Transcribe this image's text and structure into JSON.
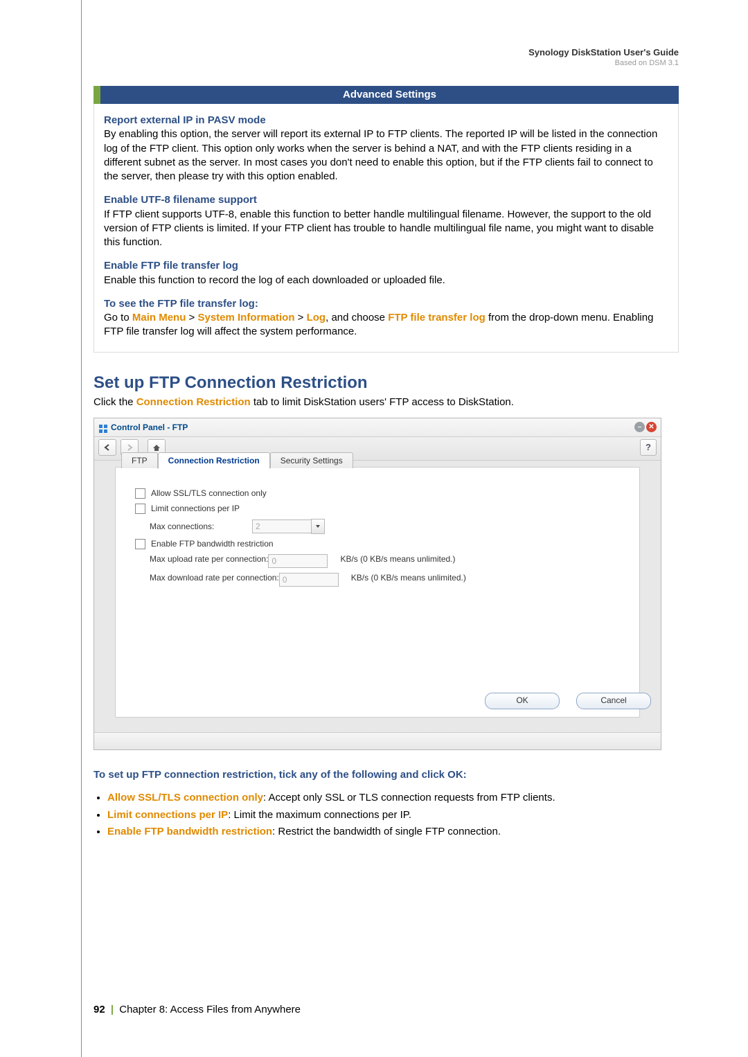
{
  "header": {
    "guide_title": "Synology DiskStation User's Guide",
    "based_on": "Based on DSM 3.1"
  },
  "adv": {
    "title": "Advanced Settings",
    "s1_title": "Report external IP in PASV mode",
    "s1_body": "By enabling this option, the server will report its external IP to FTP clients. The reported IP will be listed in the connection log of the FTP client. This option only works when the server is behind a NAT, and with the FTP clients residing in a different subnet as the server. In most cases you don't need to enable this option, but if the FTP clients fail to connect to the server, then please try with this option enabled.",
    "s2_title": "Enable UTF-8 filename support",
    "s2_body": "If FTP client supports UTF-8, enable this function to better handle multilingual filename. However, the support to the old version of FTP clients is limited. If your FTP client has trouble to handle multilingual file name, you might want to disable this function.",
    "s3_title": "Enable FTP file transfer log",
    "s3_body": "Enable this function to record the log of each downloaded or uploaded file.",
    "s4_title": "To see the FTP file transfer log:",
    "s4_pre": "Go to ",
    "s4_mm": "Main Menu",
    "s4_gt1": " > ",
    "s4_si": "System Information",
    "s4_gt2": " > ",
    "s4_log": "Log",
    "s4_mid": ", and choose ",
    "s4_ftl": "FTP file transfer log",
    "s4_post": " from the drop-down menu. Enabling FTP file transfer log will affect the system performance."
  },
  "section": {
    "heading": "Set up FTP Connection Restriction",
    "intro_pre": "Click the ",
    "intro_link": "Connection Restriction",
    "intro_post": " tab to limit DiskStation users' FTP access to DiskStation."
  },
  "win": {
    "title": "Control Panel - FTP",
    "help": "?",
    "tabs": {
      "ftp": "FTP",
      "cr": "Connection Restriction",
      "ss": "Security Settings"
    },
    "form": {
      "allow_ssl": "Allow SSL/TLS connection only",
      "limit_conn": "Limit connections per IP",
      "max_conn_label": "Max connections:",
      "max_conn_value": "2",
      "enable_bw": "Enable FTP bandwidth restriction",
      "max_up_label": "Max upload rate per connection:",
      "max_up_value": "0",
      "max_dn_label": "Max download rate per connection:",
      "max_dn_value": "0",
      "unit": "KB/s (0 KB/s means unlimited.)"
    },
    "ok": "OK",
    "cancel": "Cancel"
  },
  "instr": {
    "lead_pre": "To set up FTP connection restriction, tick any of the following and click ",
    "lead_ok": "OK",
    "lead_post": ":",
    "b1_t": "Allow SSL/TLS connection only",
    "b1_d": ": Accept only SSL or TLS connection requests from FTP clients.",
    "b2_t": "Limit connections per IP",
    "b2_d": ": Limit the maximum connections per IP.",
    "b3_t": "Enable FTP bandwidth restriction",
    "b3_d": ": Restrict the bandwidth of single FTP connection."
  },
  "footer": {
    "page": "92",
    "chapter": "Chapter 8: Access Files from Anywhere"
  }
}
